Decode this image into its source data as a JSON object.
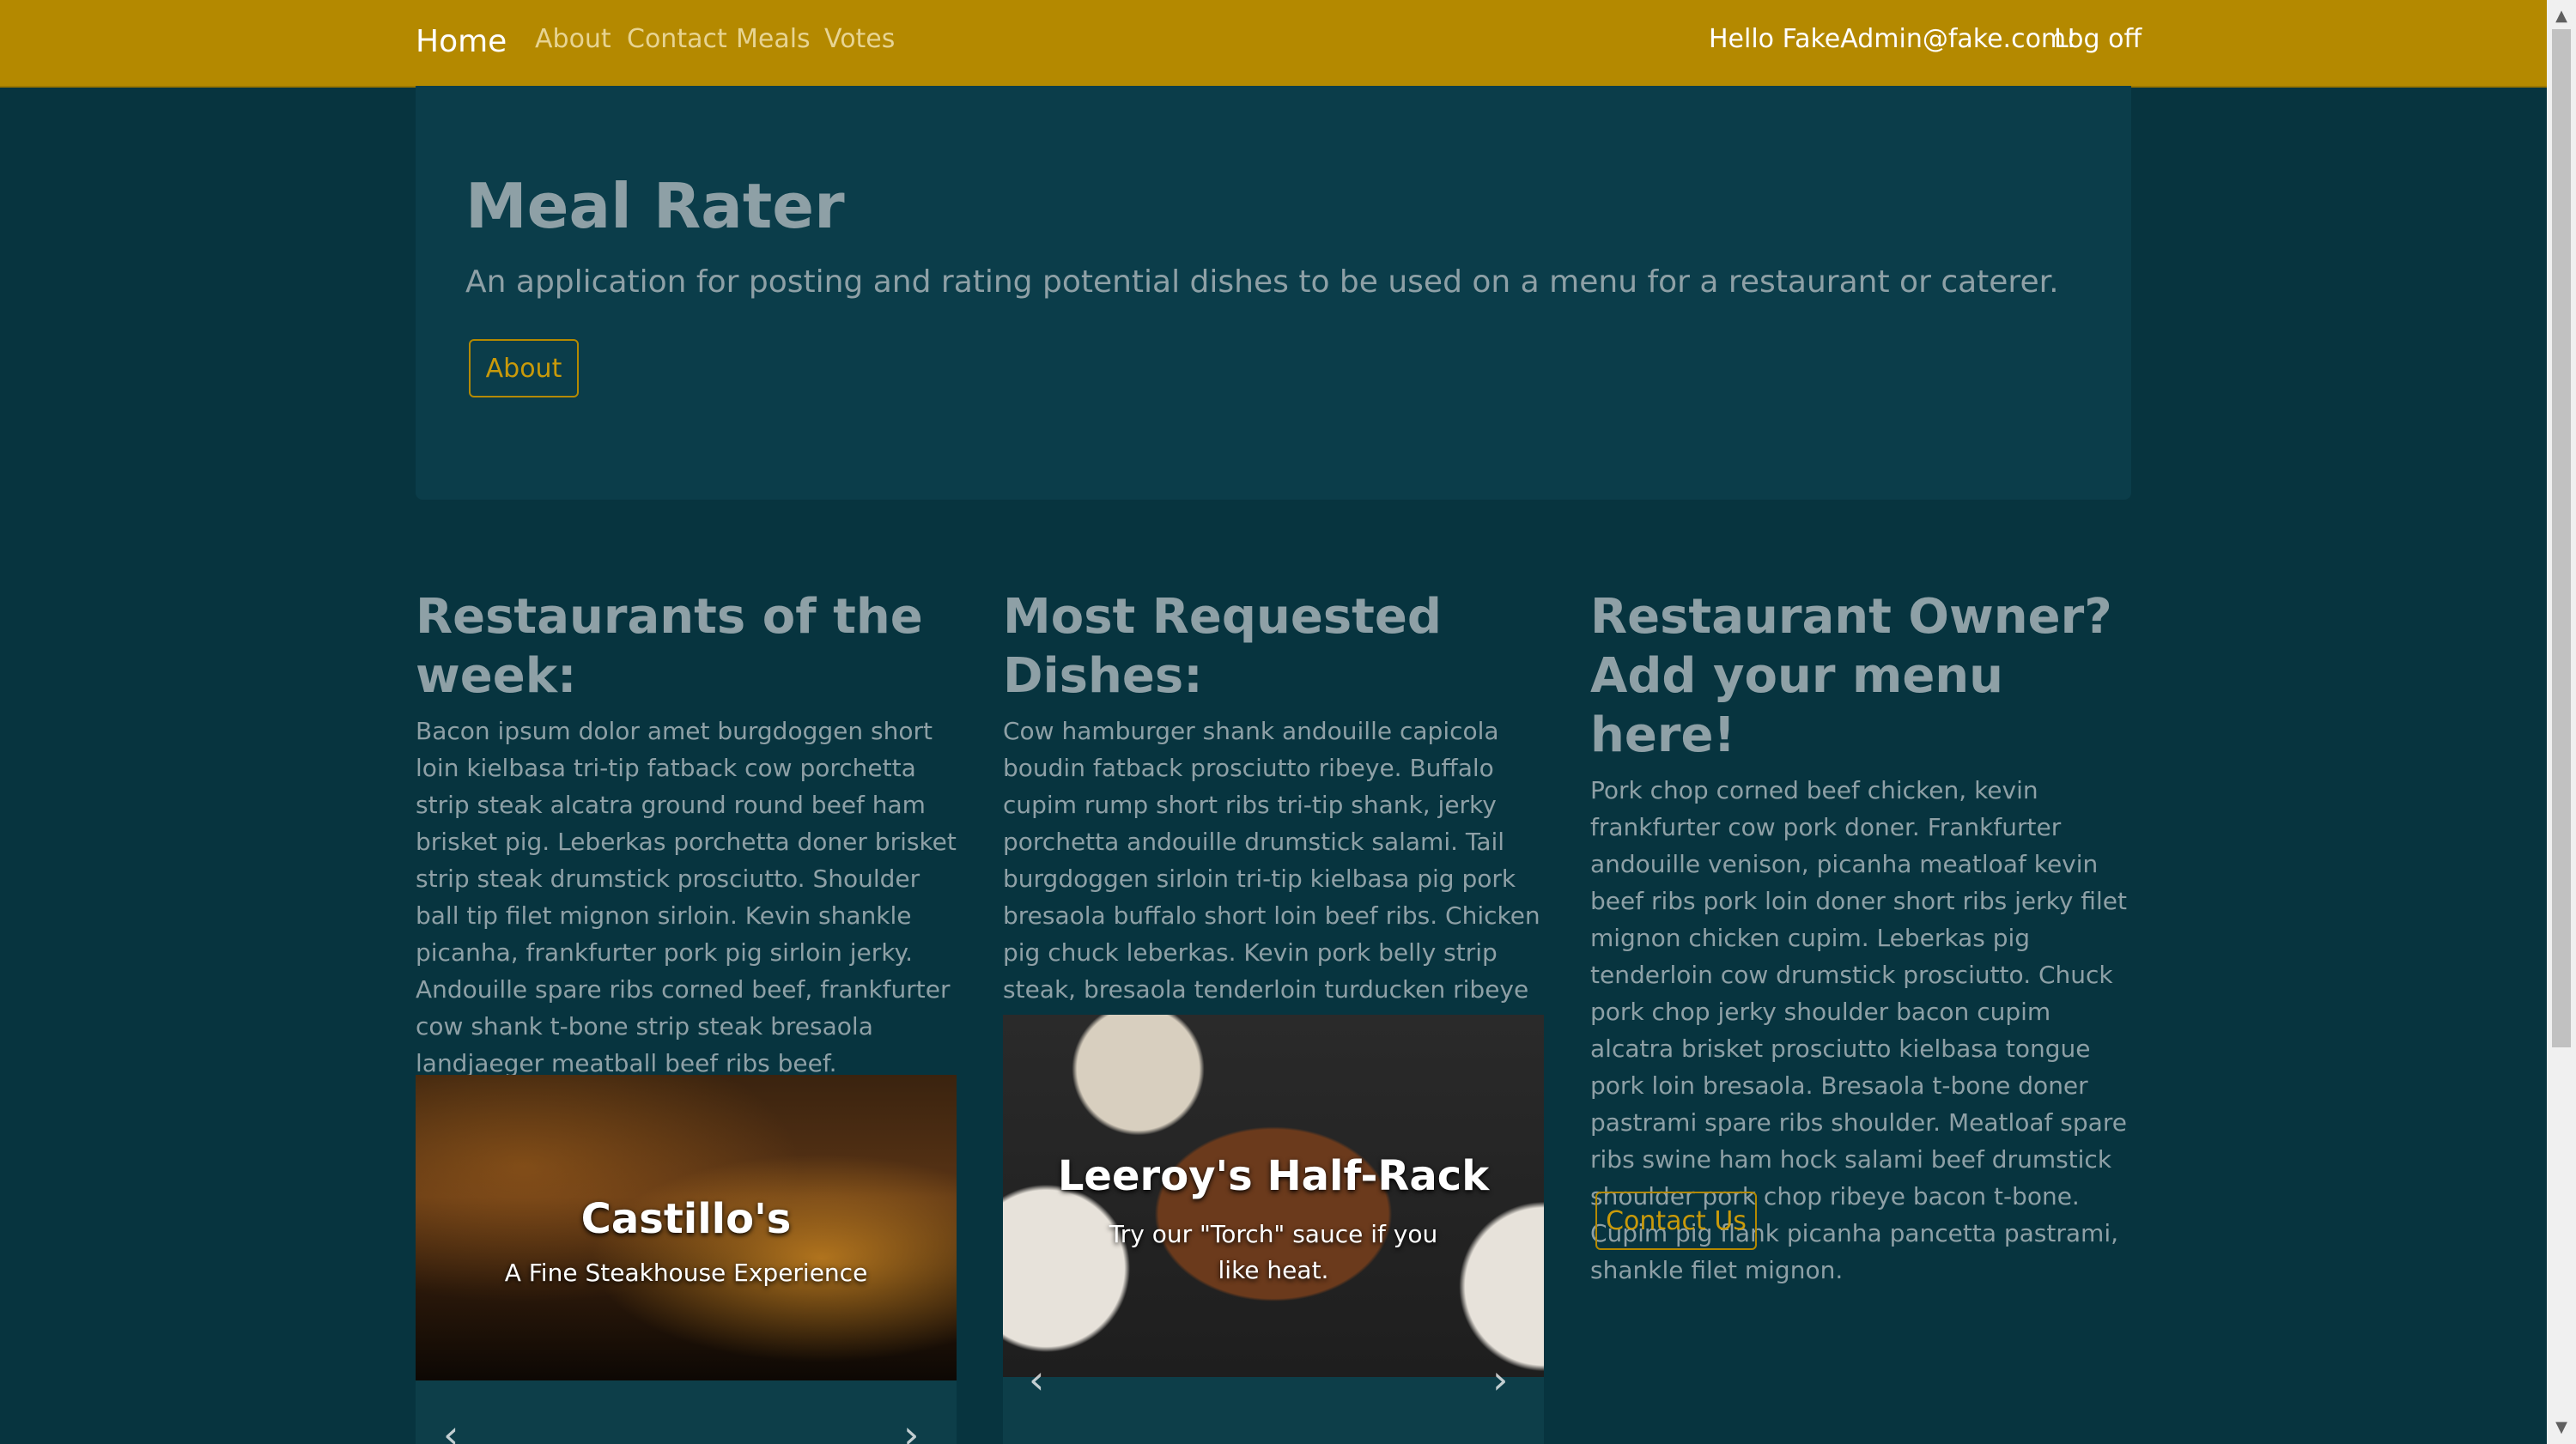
{
  "nav": {
    "brand": "Home",
    "links": [
      "About",
      "Contact",
      "Meals",
      "Votes"
    ],
    "greeting": "Hello FakeAdmin@fake.com!",
    "logoff": "Log off"
  },
  "jumbotron": {
    "title": "Meal Rater",
    "lead": "An application for posting and rating potential dishes to be used on a menu for a restaurant or caterer.",
    "button": "About"
  },
  "columns": [
    {
      "heading": "Restaurants of the week:",
      "text": "Bacon ipsum dolor amet burgdoggen short loin kielbasa tri-tip fatback cow porchetta strip steak alcatra ground round beef ham brisket pig. Leberkas porchetta doner brisket strip steak drumstick prosciutto. Shoulder ball tip filet mignon sirloin. Kevin shankle picanha, frankfurter pork pig sirloin jerky. Andouille spare ribs corned beef, frankfurter cow shank t-bone strip steak bresaola landjaeger meatball beef ribs beef."
    },
    {
      "heading": "Most Requested Dishes:",
      "text": "Cow hamburger shank andouille capicola boudin fatback prosciutto ribeye. Buffalo cupim rump short ribs tri-tip shank, jerky porchetta andouille drumstick salami. Tail burgdoggen sirloin tri-tip kielbasa pig pork bresaola buffalo short loin beef ribs. Chicken pig chuck leberkas. Kevin pork belly strip steak, bresaola tenderloin turducken ribeye tongue bacon chicken spare ribs pork chop short loin alcatra beef ribs."
    },
    {
      "heading": "Restaurant Owner? Add your menu here!",
      "text": "Pork chop corned beef chicken, kevin frankfurter cow pork doner. Frankfurter andouille venison, picanha meatloaf kevin beef ribs pork loin doner short ribs jerky filet mignon chicken cupim. Leberkas pig tenderloin cow drumstick prosciutto. Chuck pork chop jerky shoulder bacon cupim alcatra brisket prosciutto kielbasa tongue pork loin bresaola. Bresaola t-bone doner pastrami spare ribs shoulder. Meatloaf spare ribs swine ham hock salami beef drumstick shoulder pork chop ribeye bacon t-bone. Cupim pig flank picanha pancetta pastrami, shankle filet mignon.",
      "button": "Contact Us"
    }
  ],
  "carousels": [
    {
      "title": "Castillo's",
      "caption": "A Fine Steakhouse Experience"
    },
    {
      "title": "Leeroy's Half-Rack",
      "caption": "Try our \"Torch\" sauce if you like heat."
    }
  ],
  "icons": {
    "prev": "chevron-left-icon",
    "next": "chevron-right-icon",
    "cursor": "mouse-pointer-icon"
  },
  "colors": {
    "navbar": "#b48900",
    "background": "#07343f",
    "jumbotron": "#0b3d4a",
    "accent": "#c99a0a"
  }
}
